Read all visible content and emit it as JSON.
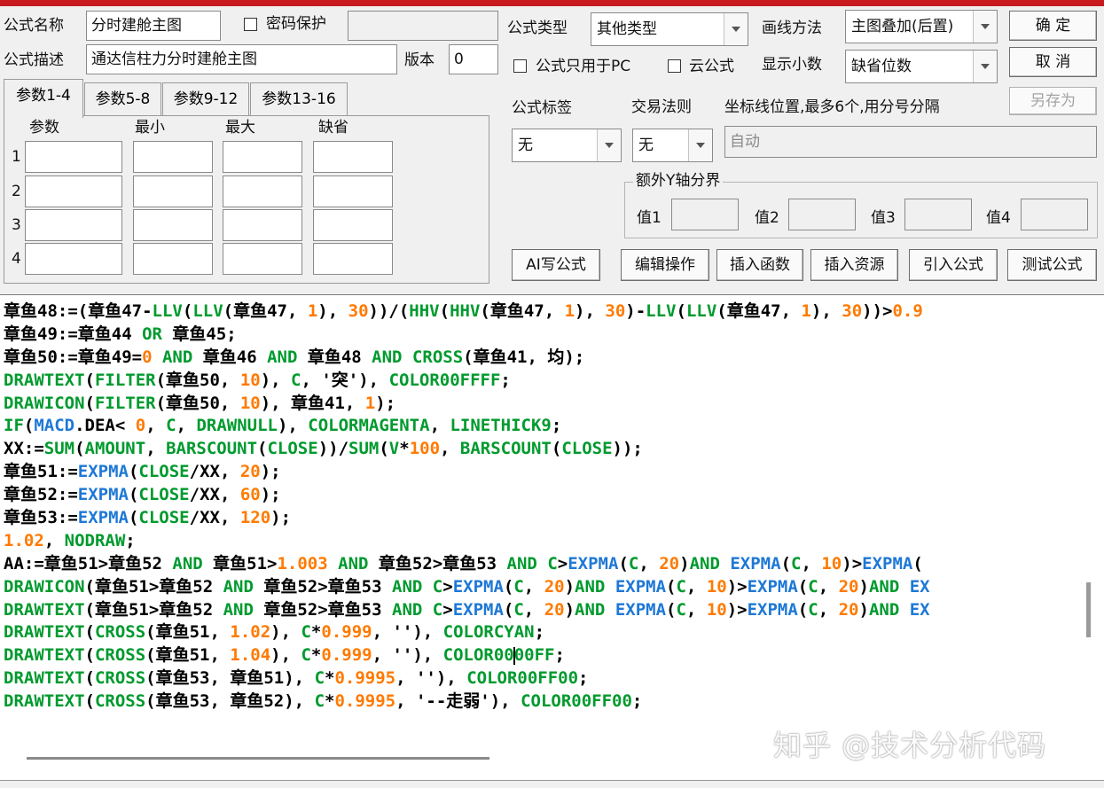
{
  "header": {
    "name_label": "公式名称",
    "name_value": "分时建舱主图",
    "pwd_label": "密码保护",
    "desc_label": "公式描述",
    "desc_value": "通达信柱力分时建舱主图",
    "version_label": "版本",
    "version_value": "0",
    "type_label": "公式类型",
    "type_value": "其他类型",
    "draw_label": "画线方法",
    "draw_value": "主图叠加(后置)",
    "pc_only_label": "公式只用于PC",
    "cloud_label": "云公式",
    "decimals_label": "显示小数",
    "decimals_value": "缺省位数",
    "ok_label": "确  定",
    "cancel_label": "取  消",
    "saveas_label": "另存为"
  },
  "tabs": [
    "参数1-4",
    "参数5-8",
    "参数9-12",
    "参数13-16"
  ],
  "params": {
    "headers": [
      "参数",
      "最小",
      "最大",
      "缺省"
    ],
    "rows": [
      "1",
      "2",
      "3",
      "4"
    ]
  },
  "right": {
    "tag_label": "公式标签",
    "tag_value": "无",
    "rule_label": "交易法则",
    "rule_value": "无",
    "axis_label": "坐标线位置,最多6个,用分号分隔",
    "axis_value": "自动",
    "extra_y_label": "额外Y轴分界",
    "val_labels": [
      "值1",
      "值2",
      "值3",
      "值4"
    ]
  },
  "buttons": {
    "ai": "AI写公式",
    "edit": "编辑操作",
    "insert_func": "插入函数",
    "insert_res": "插入资源",
    "import": "引入公式",
    "test": "测试公式"
  },
  "code_lines": [
    [
      [
        "k",
        "章鱼48:=("
      ],
      [
        "k",
        "章鱼47-"
      ],
      [
        "f",
        "LLV"
      ],
      [
        "k",
        "("
      ],
      [
        "f",
        "LLV"
      ],
      [
        "k",
        "(章鱼47, "
      ],
      [
        "n",
        "1"
      ],
      [
        "k",
        "), "
      ],
      [
        "n",
        "30"
      ],
      [
        "k",
        "))/("
      ],
      [
        "f",
        "HHV"
      ],
      [
        "k",
        "("
      ],
      [
        "f",
        "HHV"
      ],
      [
        "k",
        "(章鱼47, "
      ],
      [
        "n",
        "1"
      ],
      [
        "k",
        "), "
      ],
      [
        "n",
        "30"
      ],
      [
        "k",
        ")-"
      ],
      [
        "f",
        "LLV"
      ],
      [
        "k",
        "("
      ],
      [
        "f",
        "LLV"
      ],
      [
        "k",
        "(章鱼47, "
      ],
      [
        "n",
        "1"
      ],
      [
        "k",
        "), "
      ],
      [
        "n",
        "30"
      ],
      [
        "k",
        "))>"
      ],
      [
        "n",
        "0.9"
      ]
    ],
    [
      [
        "k",
        "章鱼49:=章鱼44 "
      ],
      [
        "f",
        "OR"
      ],
      [
        "k",
        " 章鱼45;"
      ]
    ],
    [
      [
        "k",
        "章鱼50:=章鱼49="
      ],
      [
        "n",
        "0"
      ],
      [
        "k",
        " "
      ],
      [
        "f",
        "AND"
      ],
      [
        "k",
        " 章鱼46 "
      ],
      [
        "f",
        "AND"
      ],
      [
        "k",
        " 章鱼48 "
      ],
      [
        "f",
        "AND"
      ],
      [
        "k",
        " "
      ],
      [
        "f",
        "CROSS"
      ],
      [
        "k",
        "(章鱼41, 均);"
      ]
    ],
    [
      [
        "f",
        "DRAWTEXT"
      ],
      [
        "k",
        "("
      ],
      [
        "f",
        "FILTER"
      ],
      [
        "k",
        "(章鱼50, "
      ],
      [
        "n",
        "10"
      ],
      [
        "k",
        "), "
      ],
      [
        "f",
        "C"
      ],
      [
        "k",
        ", '突'), "
      ],
      [
        "f",
        "COLOR00FFFF"
      ],
      [
        "k",
        ";"
      ]
    ],
    [
      [
        "f",
        "DRAWICON"
      ],
      [
        "k",
        "("
      ],
      [
        "f",
        "FILTER"
      ],
      [
        "k",
        "(章鱼50, "
      ],
      [
        "n",
        "10"
      ],
      [
        "k",
        "), 章鱼41, "
      ],
      [
        "n",
        "1"
      ],
      [
        "k",
        ");"
      ]
    ],
    [
      [
        "f",
        "IF"
      ],
      [
        "k",
        "("
      ],
      [
        "b",
        "MACD"
      ],
      [
        "k",
        ".DEA< "
      ],
      [
        "n",
        "0"
      ],
      [
        "k",
        ", "
      ],
      [
        "f",
        "C"
      ],
      [
        "k",
        ", "
      ],
      [
        "f",
        "DRAWNULL"
      ],
      [
        "k",
        "), "
      ],
      [
        "f",
        "COLORMAGENTA"
      ],
      [
        "k",
        ", "
      ],
      [
        "f",
        "LINETHICK9"
      ],
      [
        "k",
        ";"
      ]
    ],
    [
      [
        "k",
        "XX:="
      ],
      [
        "f",
        "SUM"
      ],
      [
        "k",
        "("
      ],
      [
        "f",
        "AMOUNT"
      ],
      [
        "k",
        ", "
      ],
      [
        "f",
        "BARSCOUNT"
      ],
      [
        "k",
        "("
      ],
      [
        "f",
        "CLOSE"
      ],
      [
        "k",
        "))/"
      ],
      [
        "f",
        "SUM"
      ],
      [
        "k",
        "("
      ],
      [
        "f",
        "V"
      ],
      [
        "k",
        "*"
      ],
      [
        "n",
        "100"
      ],
      [
        "k",
        ", "
      ],
      [
        "f",
        "BARSCOUNT"
      ],
      [
        "k",
        "("
      ],
      [
        "f",
        "CLOSE"
      ],
      [
        "k",
        "));"
      ]
    ],
    [
      [
        "k",
        "章鱼51:="
      ],
      [
        "b",
        "EXPMA"
      ],
      [
        "k",
        "("
      ],
      [
        "f",
        "CLOSE"
      ],
      [
        "k",
        "/XX, "
      ],
      [
        "n",
        "20"
      ],
      [
        "k",
        ");"
      ]
    ],
    [
      [
        "k",
        "章鱼52:="
      ],
      [
        "b",
        "EXPMA"
      ],
      [
        "k",
        "("
      ],
      [
        "f",
        "CLOSE"
      ],
      [
        "k",
        "/XX, "
      ],
      [
        "n",
        "60"
      ],
      [
        "k",
        ");"
      ]
    ],
    [
      [
        "k",
        "章鱼53:="
      ],
      [
        "b",
        "EXPMA"
      ],
      [
        "k",
        "("
      ],
      [
        "f",
        "CLOSE"
      ],
      [
        "k",
        "/XX, "
      ],
      [
        "n",
        "120"
      ],
      [
        "k",
        ");"
      ]
    ],
    [
      [
        "n",
        "1.02"
      ],
      [
        "k",
        ", "
      ],
      [
        "f",
        "NODRAW"
      ],
      [
        "k",
        ";"
      ]
    ],
    [
      [
        "k",
        "AA:=章鱼51>章鱼52 "
      ],
      [
        "f",
        "AND"
      ],
      [
        "k",
        " 章鱼51>"
      ],
      [
        "n",
        "1.003"
      ],
      [
        "k",
        " "
      ],
      [
        "f",
        "AND"
      ],
      [
        "k",
        " 章鱼52>章鱼53 "
      ],
      [
        "f",
        "AND"
      ],
      [
        "k",
        " "
      ],
      [
        "f",
        "C"
      ],
      [
        "k",
        ">"
      ],
      [
        "b",
        "EXPMA"
      ],
      [
        "k",
        "("
      ],
      [
        "f",
        "C"
      ],
      [
        "k",
        ", "
      ],
      [
        "n",
        "20"
      ],
      [
        "k",
        ")"
      ],
      [
        "f",
        "AND"
      ],
      [
        "k",
        " "
      ],
      [
        "b",
        "EXPMA"
      ],
      [
        "k",
        "("
      ],
      [
        "f",
        "C"
      ],
      [
        "k",
        ", "
      ],
      [
        "n",
        "10"
      ],
      [
        "k",
        ")>"
      ],
      [
        "b",
        "EXPMA"
      ],
      [
        "k",
        "("
      ]
    ],
    [
      [
        "f",
        "DRAWICON"
      ],
      [
        "k",
        "(章鱼51>章鱼52 "
      ],
      [
        "f",
        "AND"
      ],
      [
        "k",
        " 章鱼52>章鱼53 "
      ],
      [
        "f",
        "AND"
      ],
      [
        "k",
        " "
      ],
      [
        "f",
        "C"
      ],
      [
        "k",
        ">"
      ],
      [
        "b",
        "EXPMA"
      ],
      [
        "k",
        "("
      ],
      [
        "f",
        "C"
      ],
      [
        "k",
        ", "
      ],
      [
        "n",
        "20"
      ],
      [
        "k",
        ")"
      ],
      [
        "f",
        "AND"
      ],
      [
        "k",
        " "
      ],
      [
        "b",
        "EXPMA"
      ],
      [
        "k",
        "("
      ],
      [
        "f",
        "C"
      ],
      [
        "k",
        ", "
      ],
      [
        "n",
        "10"
      ],
      [
        "k",
        ")>"
      ],
      [
        "b",
        "EXPMA"
      ],
      [
        "k",
        "("
      ],
      [
        "f",
        "C"
      ],
      [
        "k",
        ", "
      ],
      [
        "n",
        "20"
      ],
      [
        "k",
        ")"
      ],
      [
        "f",
        "AND"
      ],
      [
        "k",
        " "
      ],
      [
        "b",
        "EX"
      ]
    ],
    [
      [
        "f",
        "DRAWTEXT"
      ],
      [
        "k",
        "(章鱼51>章鱼52 "
      ],
      [
        "f",
        "AND"
      ],
      [
        "k",
        " 章鱼52>章鱼53 "
      ],
      [
        "f",
        "AND"
      ],
      [
        "k",
        " "
      ],
      [
        "f",
        "C"
      ],
      [
        "k",
        ">"
      ],
      [
        "b",
        "EXPMA"
      ],
      [
        "k",
        "("
      ],
      [
        "f",
        "C"
      ],
      [
        "k",
        ", "
      ],
      [
        "n",
        "20"
      ],
      [
        "k",
        ")"
      ],
      [
        "f",
        "AND"
      ],
      [
        "k",
        " "
      ],
      [
        "b",
        "EXPMA"
      ],
      [
        "k",
        "("
      ],
      [
        "f",
        "C"
      ],
      [
        "k",
        ", "
      ],
      [
        "n",
        "10"
      ],
      [
        "k",
        ")>"
      ],
      [
        "b",
        "EXPMA"
      ],
      [
        "k",
        "("
      ],
      [
        "f",
        "C"
      ],
      [
        "k",
        ", "
      ],
      [
        "n",
        "20"
      ],
      [
        "k",
        ")"
      ],
      [
        "f",
        "AND"
      ],
      [
        "k",
        " "
      ],
      [
        "b",
        "EX"
      ]
    ],
    [
      [
        "f",
        "DRAWTEXT"
      ],
      [
        "k",
        "("
      ],
      [
        "f",
        "CROSS"
      ],
      [
        "k",
        "(章鱼51, "
      ],
      [
        "n",
        "1.02"
      ],
      [
        "k",
        "), "
      ],
      [
        "f",
        "C"
      ],
      [
        "k",
        "*"
      ],
      [
        "n",
        "0.999"
      ],
      [
        "k",
        ", ''), "
      ],
      [
        "f",
        "COLORCYAN"
      ],
      [
        "k",
        ";"
      ]
    ],
    [
      [
        "f",
        "DRAWTEXT"
      ],
      [
        "k",
        "("
      ],
      [
        "f",
        "CROSS"
      ],
      [
        "k",
        "(章鱼51, "
      ],
      [
        "n",
        "1.04"
      ],
      [
        "k",
        "), "
      ],
      [
        "f",
        "C"
      ],
      [
        "k",
        "*"
      ],
      [
        "n",
        "0.999"
      ],
      [
        "k",
        ", ''), "
      ],
      [
        "f",
        "COLOR00"
      ],
      [
        "cursor",
        ""
      ],
      [
        "f",
        "00FF"
      ],
      [
        "k",
        ";"
      ]
    ],
    [
      [
        "f",
        "DRAWTEXT"
      ],
      [
        "k",
        "("
      ],
      [
        "f",
        "CROSS"
      ],
      [
        "k",
        "(章鱼53, 章鱼51), "
      ],
      [
        "f",
        "C"
      ],
      [
        "k",
        "*"
      ],
      [
        "n",
        "0.9995"
      ],
      [
        "k",
        ", ''), "
      ],
      [
        "f",
        "COLOR00FF00"
      ],
      [
        "k",
        ";"
      ]
    ],
    [
      [
        "f",
        "DRAWTEXT"
      ],
      [
        "k",
        "("
      ],
      [
        "f",
        "CROSS"
      ],
      [
        "k",
        "(章鱼53, 章鱼52), "
      ],
      [
        "f",
        "C"
      ],
      [
        "k",
        "*"
      ],
      [
        "n",
        "0.9995"
      ],
      [
        "k",
        ", '--走弱'), "
      ],
      [
        "f",
        "COLOR00FF00"
      ],
      [
        "k",
        ";"
      ]
    ]
  ],
  "watermark": "知乎 @技术分析代码",
  "colors": {
    "keyword": "#009a2e",
    "number": "#ff7a00",
    "builtin": "#1e78d6",
    "accent_bar": "#c8191e"
  }
}
